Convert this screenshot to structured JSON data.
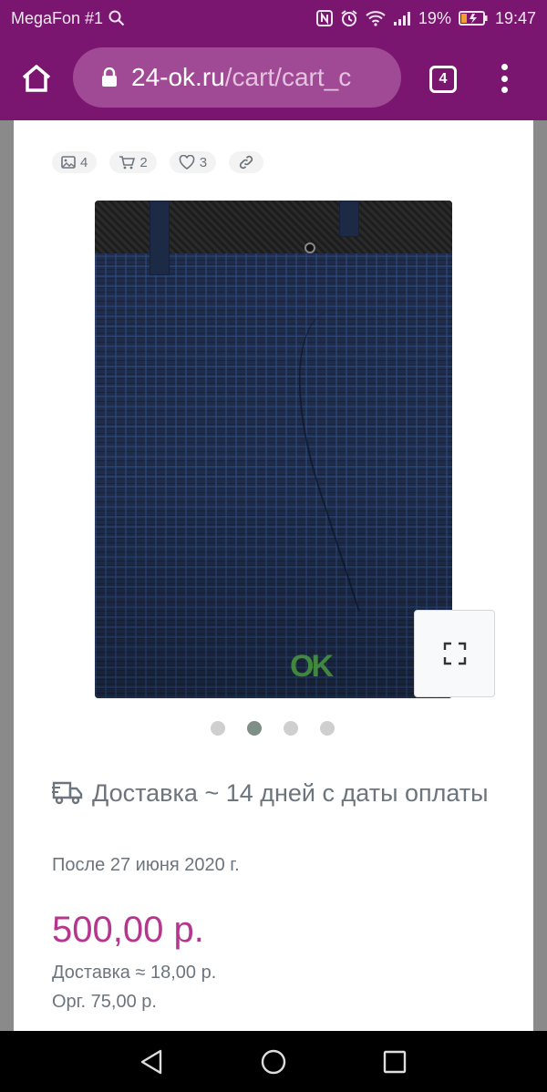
{
  "status_bar": {
    "carrier": "MegaFon #1",
    "battery": "19%",
    "time": "19:47"
  },
  "browser": {
    "url_domain": "24-ok.ru",
    "url_path": "/cart/cart_c",
    "tab_count": "4"
  },
  "product": {
    "stats": {
      "photos": "4",
      "cart": "2",
      "likes": "3"
    },
    "gallery": {
      "slides": 4,
      "active_slide": 2,
      "watermark": "OK"
    },
    "delivery": "Доставка ~ 14 дней с даты оплаты",
    "after_date": "После 27 июня 2020 г.",
    "price": "500,00 р.",
    "shipping_cost": "Доставка ≈ 18,00 р.",
    "org_fee": "Орг. 75,00 р."
  },
  "colors": {
    "browser_bar": "#7b1670",
    "price": "#b5368e",
    "muted_text": "#6c757d",
    "active_dot": "#7e8f87"
  }
}
